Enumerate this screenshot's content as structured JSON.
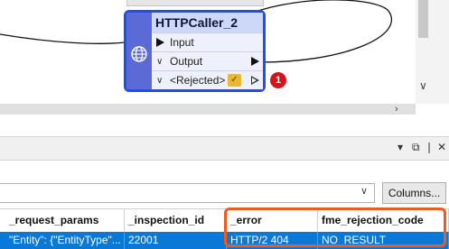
{
  "node": {
    "title": "HTTPCaller_2",
    "ports": {
      "input_label": "Input",
      "output_label": "Output",
      "rejected_label": "<Rejected>"
    },
    "rejected_count": "1"
  },
  "columns_button_label": "Columns...",
  "table": {
    "headers": [
      "_request_params",
      "_inspection_id",
      "_error",
      "fme_rejection_code"
    ],
    "row": {
      "request_params": "\"Entity\": {\"EntityType\"...",
      "inspection_id": "22001",
      "error": "HTTP/2 404",
      "rejection_code": "NO_RESULT"
    }
  },
  "colors": {
    "node_border": "#1e4ef2",
    "selected_row": "#0a78d7",
    "highlight": "#f05a1e",
    "badge": "#d3141c"
  },
  "icons": [
    "globe-icon",
    "inspect-icon",
    "chevron-down-icon",
    "pin-icon",
    "float-icon",
    "close-icon"
  ]
}
